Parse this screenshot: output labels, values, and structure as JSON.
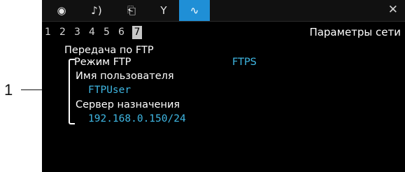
{
  "callout": {
    "number": "1"
  },
  "tabs": [
    {
      "name": "camera-icon",
      "glyph": "◉"
    },
    {
      "name": "audio-icon",
      "glyph": "♪)"
    },
    {
      "name": "display-settings-icon",
      "glyph": "⎗"
    },
    {
      "name": "wrench-icon",
      "glyph": "Y"
    },
    {
      "name": "network-icon",
      "glyph": "∿",
      "active": true
    }
  ],
  "close_glyph": "✕",
  "pages": [
    "1",
    "2",
    "3",
    "4",
    "5",
    "6",
    "7"
  ],
  "active_page": "7",
  "page_title": "Параметры сети",
  "section": {
    "title": "Передача по FTP",
    "ftp_mode_label": "Режим FTP",
    "ftp_mode_value": "FTPS",
    "username_label": "Имя пользователя",
    "username_value": "FTPUser",
    "server_label": "Сервер назначения",
    "server_value": "192.168.0.150/24"
  },
  "colors": {
    "value_text": "#3fb7e3",
    "active_tab": "#1f8fd6",
    "background": "#000000"
  }
}
